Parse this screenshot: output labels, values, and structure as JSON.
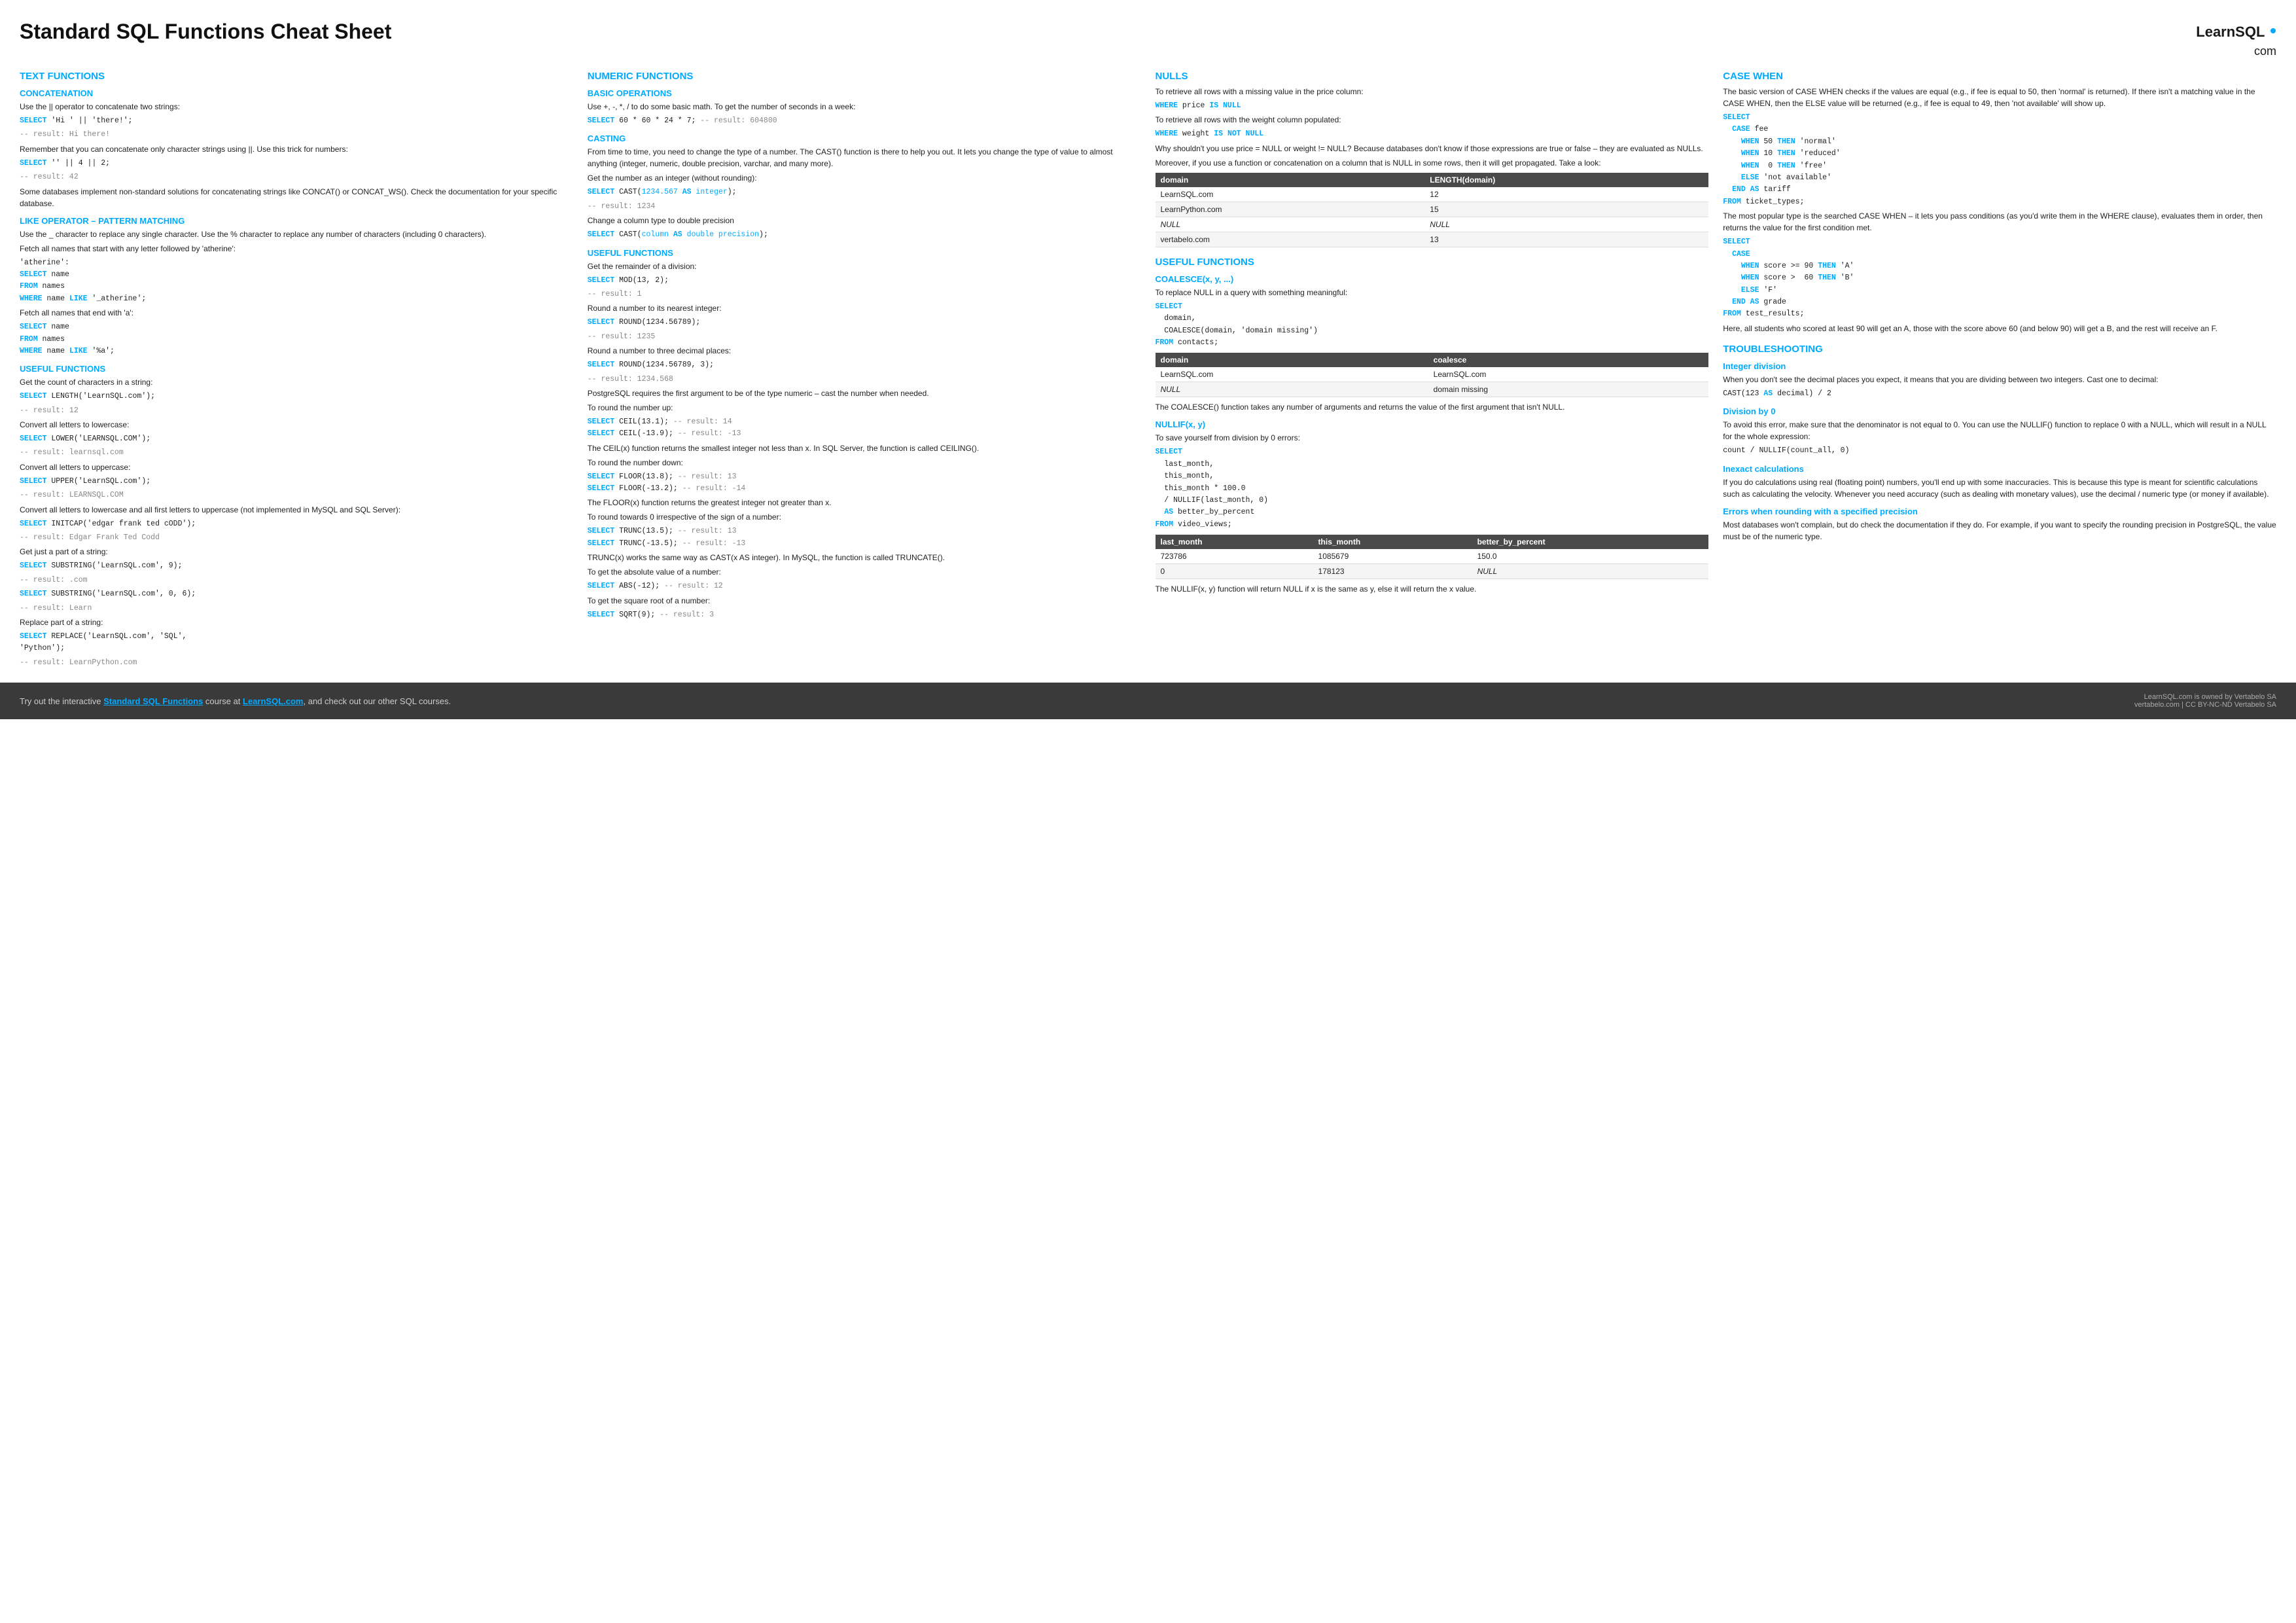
{
  "header": {
    "title": "Standard SQL Functions Cheat Sheet",
    "logo_line1": "LearnSQL",
    "logo_dot": "•",
    "logo_line2": "com"
  },
  "col1": {
    "section": "TEXT FUNCTIONS",
    "sub1": "CONCATENATION",
    "concat_p1": "Use the || operator to concatenate two strings:",
    "concat_code1": "SELECT 'Hi ' || 'there!';",
    "concat_code1_comment": "-- result: Hi there!",
    "concat_p2": "Remember that you can concatenate only character strings using ||. Use this trick for numbers:",
    "concat_code2": "SELECT '' || 4 || 2;",
    "concat_code2_comment": "-- result: 42",
    "concat_p3": "Some databases implement non-standard solutions for concatenating strings like CONCAT() or CONCAT_WS(). Check the documentation for your specific database.",
    "sub2": "LIKE OPERATOR – PATTERN MATCHING",
    "like_p1": "Use the _ character to replace any single character. Use the % character to replace any number of characters (including 0 characters).",
    "like_p2": "Fetch all names that start with any letter followed by 'atherine':",
    "like_code1a": "'atherine':",
    "like_code1b": "SELECT name",
    "like_code1c": "FROM names",
    "like_code1d": "WHERE name LIKE '_atherine';",
    "like_p3": "Fetch all names that end with 'a':",
    "like_code2a": "SELECT name",
    "like_code2b": "FROM names",
    "like_code2c": "WHERE name LIKE '%a';",
    "sub3": "USEFUL FUNCTIONS",
    "uf_p1": "Get the count of characters in a string:",
    "uf_code1a": "SELECT LENGTH('LearnSQL.com');",
    "uf_code1b": "-- result: 12",
    "uf_p2": "Convert all letters to lowercase:",
    "uf_code2a": "SELECT LOWER('LEARNSQL.COM');",
    "uf_code2b": "-- result: learnsql.com",
    "uf_p3": "Convert all letters to uppercase:",
    "uf_code3a": "SELECT UPPER('LearnSQL.com');",
    "uf_code3b": "-- result: LEARNSQL.COM",
    "uf_p4": "Convert all letters to lowercase and all first letters to uppercase (not implemented in MySQL and SQL Server):",
    "uf_code4a": "SELECT INITCAP('edgar frank ted cODD');",
    "uf_code4b": "-- result: Edgar Frank Ted Codd",
    "uf_p5": "Get just a part of a string:",
    "uf_code5a": "SELECT SUBSTRING('LearnSQL.com', 9);",
    "uf_code5b": "-- result: .com",
    "uf_code5c": "SELECT SUBSTRING('LearnSQL.com', 0, 6);",
    "uf_code5d": "-- result: Learn",
    "uf_p6": "Replace part of a string:",
    "uf_code6a": "SELECT REPLACE('LearnSQL.com', 'SQL',",
    "uf_code6b": "'Python');",
    "uf_code6c": "-- result: LearnPython.com"
  },
  "col2": {
    "section": "NUMERIC FUNCTIONS",
    "sub1": "BASIC OPERATIONS",
    "bo_p1": "Use +, -, *, / to do some basic math. To get the number of seconds in a week:",
    "bo_code1": "SELECT 60 * 60 * 24 * 7; -- result: 604800",
    "sub2": "CASTING",
    "cast_p1": "From time to time, you need to change the type of a number. The CAST() function is there to help you out. It lets you change the type of value to almost anything (integer, numeric, double precision, varchar, and many more).",
    "cast_p2": "Get the number as an integer (without rounding):",
    "cast_code1a": "SELECT CAST(1234.567 AS integer);",
    "cast_code1b": "-- result: 1234",
    "cast_p3": "Change a column type to double precision",
    "cast_code2a": "SELECT CAST(column AS double precision);",
    "sub3": "USEFUL FUNCTIONS",
    "uf2_p1": "Get the remainder of a division:",
    "uf2_code1a": "SELECT MOD(13, 2);",
    "uf2_code1b": "-- result: 1",
    "uf2_p2": "Round a number to its nearest integer:",
    "uf2_code2a": "SELECT ROUND(1234.56789);",
    "uf2_code2b": "-- result: 1235",
    "uf2_p3": "Round a number to three decimal places:",
    "uf2_code3a": "SELECT ROUND(1234.56789, 3);",
    "uf2_code3b": "-- result: 1234.568",
    "uf2_p4": "PostgreSQL requires the first argument to be of the type numeric – cast the number when needed.",
    "uf2_p5": "To round the number up:",
    "uf2_code4a": "SELECT CEIL(13.1); -- result: 14",
    "uf2_code4b": "SELECT CEIL(-13.9); -- result: -13",
    "uf2_p6": "The CEIL(x) function returns the smallest integer not less than x. In SQL Server, the function is called CEILING().",
    "uf2_p7": "To round the number down:",
    "uf2_code5a": "SELECT FLOOR(13.8); -- result: 13",
    "uf2_code5b": "SELECT FLOOR(-13.2); -- result: -14",
    "uf2_p8": "The FLOOR(x) function returns the greatest integer not greater than x.",
    "uf2_p9": "To round towards 0 irrespective of the sign of a number:",
    "uf2_code6a": "SELECT TRUNC(13.5); -- result: 13",
    "uf2_code6b": "SELECT TRUNC(-13.5); -- result: -13",
    "uf2_p10": "TRUNC(x) works the same way as CAST(x AS integer). In MySQL, the function is called TRUNCATE().",
    "uf2_p11": "To get the absolute value of a number:",
    "uf2_code7a": "SELECT ABS(-12); -- result: 12",
    "uf2_p12": "To get the square root of a number:",
    "uf2_code8a": "SELECT SQRT(9); -- result: 3"
  },
  "col3": {
    "section1": "NULLs",
    "null_p1": "To retrieve all rows with a missing value in the price column:",
    "null_code1": "WHERE price IS NULL",
    "null_p2": "To retrieve all rows with the weight column populated:",
    "null_code2": "WHERE weight IS NOT NULL",
    "null_p3": "Why shouldn't you use price = NULL or weight != NULL? Because databases don't know if those expressions are true or false – they are evaluated as NULLs.",
    "null_p4": "Moreover, if you use a function or concatenation on a column that is NULL in some rows, then it will get propagated. Take a look:",
    "null_table_headers": [
      "domain",
      "LENGTH(domain)"
    ],
    "null_table_rows": [
      [
        "LearnSQL.com",
        "12"
      ],
      [
        "LearnPython.com",
        "15"
      ],
      [
        "NULL",
        "NULL"
      ],
      [
        "vertabelo.com",
        "13"
      ]
    ],
    "section2": "USEFUL FUNCTIONS",
    "coalesce_title": "COALESCE(x, y, ...)",
    "coalesce_p1": "To replace NULL in a query with something meaningful:",
    "coalesce_code1a": "SELECT",
    "coalesce_code1b": "  domain,",
    "coalesce_code1c": "  COALESCE(domain, 'domain missing')",
    "coalesce_code1d": "FROM contacts;",
    "coalesce_table_headers": [
      "domain",
      "coalesce"
    ],
    "coalesce_table_rows": [
      [
        "LearnSQL.com",
        "LearnSQL.com"
      ],
      [
        "NULL",
        "domain missing"
      ]
    ],
    "coalesce_p2": "The COALESCE() function takes any number of arguments and returns the value of the first argument that isn't NULL.",
    "nullif_title": "NULLIF(x, y)",
    "nullif_p1": "To save yourself from division by 0 errors:",
    "nullif_code1a": "SELECT",
    "nullif_code1b": "  last_month,",
    "nullif_code1c": "  this_month,",
    "nullif_code1d": "  this_month * 100.0",
    "nullif_code1e": "  / NULLIF(last_month, 0)",
    "nullif_code1f": "  AS better_by_percent",
    "nullif_code1g": "FROM video_views;",
    "nullif_table_headers": [
      "last_month",
      "this_month",
      "better_by_percent"
    ],
    "nullif_table_rows": [
      [
        "723786",
        "1085679",
        "150.0"
      ],
      [
        "0",
        "178123",
        "NULL"
      ]
    ],
    "nullif_p2": "The NULLIF(x, y) function will return NULL if x is the same as y, else it will return the x value."
  },
  "col4": {
    "section1": "CASE WHEN",
    "cw_p1": "The basic version of CASE WHEN checks if the values are equal (e.g., if fee is equal to 50, then 'normal' is returned). If there isn't a matching value in the CASE WHEN, then the ELSE value will be returned (e.g., if fee is equal to 49, then 'not available' will show up.",
    "cw_code1a": "SELECT",
    "cw_code1b": "  CASE fee",
    "cw_code1c": "    WHEN 50 THEN 'normal'",
    "cw_code1d": "    WHEN 10 THEN 'reduced'",
    "cw_code1e": "    WHEN  0 THEN 'free'",
    "cw_code1f": "    ELSE 'not available'",
    "cw_code1g": "  END AS tariff",
    "cw_code1h": "FROM ticket_types;",
    "cw_p2": "The most popular type is the searched CASE WHEN – it lets you pass conditions (as you'd write them in the WHERE clause), evaluates them in order, then returns the value for the first condition met.",
    "cw_code2a": "SELECT",
    "cw_code2b": "  CASE",
    "cw_code2c": "    WHEN score >= 90 THEN 'A'",
    "cw_code2d": "    WHEN score >  60 THEN 'B'",
    "cw_code2e": "    ELSE 'F'",
    "cw_code2f": "  END AS grade",
    "cw_code2g": "FROM test_results;",
    "cw_p3": "Here, all students who scored at least 90 will get an A, those with the score above 60 (and below 90) will get a B, and the rest will receive an F.",
    "section2": "TROUBLESHOOTING",
    "ts_sub1": "Integer division",
    "ts_p1": "When you don't see the decimal places you expect, it means that you are dividing between two integers. Cast one to decimal:",
    "ts_code1": "CAST(123 AS decimal) / 2",
    "ts_sub2": "Division by 0",
    "ts_p2": "To avoid this error, make sure that the denominator is not equal to 0. You can use the NULLIF() function to replace 0 with a NULL, which will result in a NULL for the whole expression:",
    "ts_code2": "count / NULLIF(count_all, 0)",
    "ts_sub3": "Inexact calculations",
    "ts_p3": "If you do calculations using real (floating point) numbers, you'll end up with some inaccuracies. This is because this type is meant for scientific calculations such as calculating the velocity. Whenever you need accuracy (such as dealing with monetary values), use the decimal / numeric type (or money if available).",
    "ts_sub4": "Errors when rounding with a specified precision",
    "ts_p4": "Most databases won't complain, but do check the documentation if they do. For example, if you want to specify the rounding precision in PostgreSQL, the value must be of the numeric type."
  },
  "footer": {
    "text1": "Try out the interactive ",
    "link1": "Standard SQL Functions",
    "text2": " course at ",
    "link2": "LearnSQL.com",
    "text3": ", and check out our other SQL courses.",
    "right1": "LearnSQL.com is owned by Vertabelo SA",
    "right2": "vertabelo.com | CC BY-NC-ND Vertabelo SA"
  }
}
